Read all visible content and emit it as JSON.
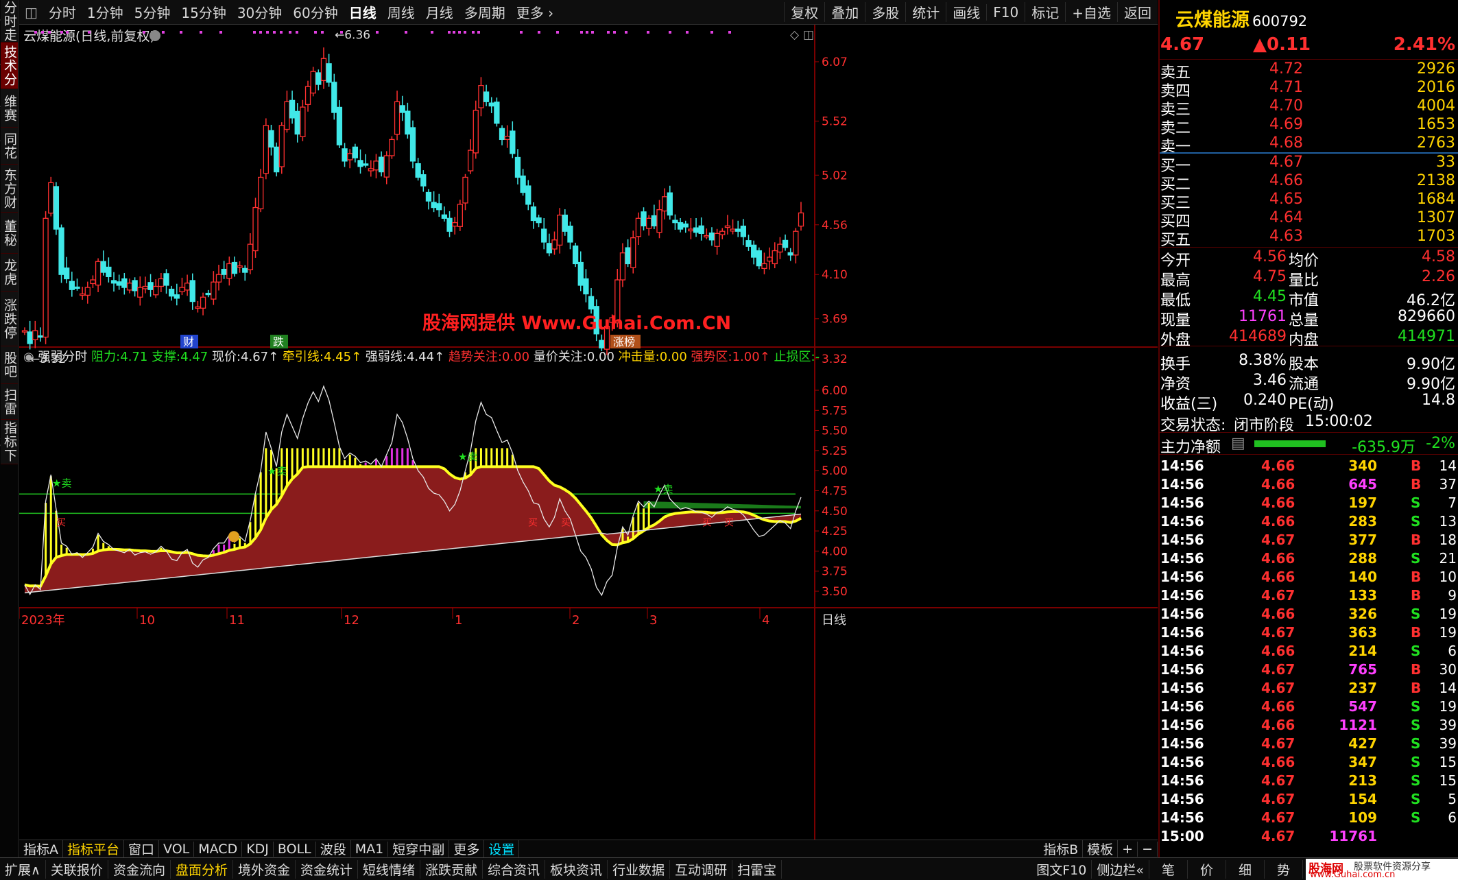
{
  "toolbar": {
    "left": [
      "分时",
      "1分钟",
      "5分钟",
      "15分钟",
      "30分钟",
      "60分钟",
      "日线",
      "周线",
      "月线",
      "多周期",
      "更多 ›"
    ],
    "active": "日线",
    "right": [
      "复权",
      "叠加",
      "多股",
      "统计",
      "画线",
      "F10",
      "标记",
      "+自选",
      "返回"
    ]
  },
  "sidebar": [
    "分时走势",
    "技术分析",
    "维赛特",
    "同花顺",
    "东方财富",
    "董秘互动",
    "龙虎榜",
    "涨跌停原因",
    "股吧",
    "扫雷宝",
    "指标下载"
  ],
  "sidebar_active": "技术分析",
  "main_chart": {
    "title": "云煤能源(日线,前复权)",
    "y_ticks": [
      "6.07",
      "5.52",
      "5.02",
      "4.56",
      "4.10",
      "3.69",
      "3.32"
    ],
    "high_label": "6.36",
    "low_label": "3.32",
    "event_tags": [
      "财",
      "跌",
      "涨榜"
    ],
    "watermark": "股海网提供 Www.Guhai.Com.CN"
  },
  "indicator": {
    "name": "强弱分时",
    "items": [
      {
        "label": "阻力:",
        "value": "4.71"
      },
      {
        "label": "支撑:",
        "value": "4.47"
      },
      {
        "label": "现价:",
        "value": "4.67↑"
      },
      {
        "label": "牵引线:",
        "value": "4.45↑"
      },
      {
        "label": "强弱线:",
        "value": "4.44↑"
      },
      {
        "label": "趋势关注:",
        "value": "0.00"
      },
      {
        "label": "量价关注:",
        "value": "0.00"
      },
      {
        "label": "冲击量:",
        "value": "0.00"
      },
      {
        "label": "强势区:",
        "value": "1.00↑"
      },
      {
        "label": "止损区:",
        "value": "-"
      }
    ],
    "y_ticks": [
      "6.00",
      "5.75",
      "5.50",
      "5.25",
      "5.00",
      "4.75",
      "4.50",
      "4.25",
      "4.00",
      "3.75",
      "3.50"
    ],
    "signals": {
      "sell": "卖",
      "buy": "买"
    }
  },
  "x_axis": {
    "labels": [
      "2023年",
      "10",
      "11",
      "12",
      "1",
      "2",
      "3",
      "4"
    ],
    "period": "日线"
  },
  "indicator_tabs": [
    "指标A",
    "指标平台",
    "窗口",
    "VOL",
    "MACD",
    "KDJ",
    "BOLL",
    "波段",
    "MA1",
    "短穿中副",
    "更多",
    "设置"
  ],
  "indicator_tabs_right": [
    "指标B",
    "模板",
    "+",
    "−"
  ],
  "quote": {
    "name": "云煤能源",
    "code": "600792",
    "price": "4.67",
    "change": "▲0.11",
    "pct": "2.41%",
    "sell": [
      {
        "l": "卖五",
        "p": "4.72",
        "v": "2926"
      },
      {
        "l": "卖四",
        "p": "4.71",
        "v": "2016"
      },
      {
        "l": "卖三",
        "p": "4.70",
        "v": "4004"
      },
      {
        "l": "卖二",
        "p": "4.69",
        "v": "1653"
      },
      {
        "l": "卖一",
        "p": "4.68",
        "v": "2763"
      }
    ],
    "buy": [
      {
        "l": "买一",
        "p": "4.67",
        "v": "33"
      },
      {
        "l": "买二",
        "p": "4.66",
        "v": "2138"
      },
      {
        "l": "买三",
        "p": "4.65",
        "v": "1684"
      },
      {
        "l": "买四",
        "p": "4.64",
        "v": "1307"
      },
      {
        "l": "买五",
        "p": "4.63",
        "v": "1703"
      }
    ],
    "stats": [
      [
        "今开",
        "4.56",
        "均价",
        "4.58"
      ],
      [
        "最高",
        "4.75",
        "量比",
        "2.26"
      ],
      [
        "最低",
        "4.45",
        "市值",
        "46.2亿"
      ],
      [
        "现量",
        "11761",
        "总量",
        "829660"
      ],
      [
        "外盘",
        "414689",
        "内盘",
        "414971"
      ],
      [
        "换手",
        "8.38%",
        "股本",
        "9.90亿"
      ],
      [
        "净资",
        "3.46",
        "流通",
        "9.90亿"
      ],
      [
        "收益(三)",
        "0.240",
        "PE(动)",
        "14.8"
      ]
    ],
    "trade_status_label": "交易状态:",
    "trade_status": "闭市阶段",
    "trade_time": "15:00:02",
    "net_label": "主力净额",
    "net_value": "-635.9万",
    "net_pct": "-2%"
  },
  "ticks": [
    [
      "14:56",
      "4.66",
      "340",
      "B",
      "14"
    ],
    [
      "14:56",
      "4.66",
      "645",
      "B",
      "37"
    ],
    [
      "14:56",
      "4.66",
      "197",
      "S",
      "7"
    ],
    [
      "14:56",
      "4.66",
      "283",
      "S",
      "13"
    ],
    [
      "14:56",
      "4.67",
      "377",
      "B",
      "18"
    ],
    [
      "14:56",
      "4.66",
      "288",
      "S",
      "21"
    ],
    [
      "14:56",
      "4.66",
      "140",
      "B",
      "10"
    ],
    [
      "14:56",
      "4.67",
      "133",
      "B",
      "9"
    ],
    [
      "14:56",
      "4.66",
      "326",
      "S",
      "19"
    ],
    [
      "14:56",
      "4.67",
      "363",
      "B",
      "19"
    ],
    [
      "14:56",
      "4.66",
      "214",
      "S",
      "6"
    ],
    [
      "14:56",
      "4.67",
      "765",
      "B",
      "30"
    ],
    [
      "14:56",
      "4.67",
      "237",
      "B",
      "14"
    ],
    [
      "14:56",
      "4.66",
      "547",
      "S",
      "19"
    ],
    [
      "14:56",
      "4.66",
      "1121",
      "S",
      "39"
    ],
    [
      "14:56",
      "4.67",
      "427",
      "S",
      "39"
    ],
    [
      "14:56",
      "4.66",
      "347",
      "S",
      "15"
    ],
    [
      "14:56",
      "4.67",
      "213",
      "S",
      "15"
    ],
    [
      "14:56",
      "4.67",
      "154",
      "S",
      "5"
    ],
    [
      "14:56",
      "4.67",
      "109",
      "S",
      "6"
    ],
    [
      "15:00",
      "4.67",
      "11761",
      "",
      ""
    ]
  ],
  "bottom": [
    "扩展∧",
    "关联报价",
    "资金流向",
    "盘面分析",
    "境外资金",
    "资金统计",
    "短线情绪",
    "涨跌贡献",
    "综合资讯",
    "板块资讯",
    "行业数据",
    "互动调研",
    "扫雷宝"
  ],
  "bottom_right": [
    "图文F10",
    "侧边栏«",
    "笔",
    "价",
    "细",
    "势"
  ],
  "logo": {
    "site": "股海网",
    "slogan": "股票软件资源分享",
    "url": "www.Guhai.com.cn"
  },
  "colors": {
    "up": "#ff3030",
    "down": "#40e8e8",
    "sell_bg": "#000",
    "buy_bg": "#000"
  }
}
